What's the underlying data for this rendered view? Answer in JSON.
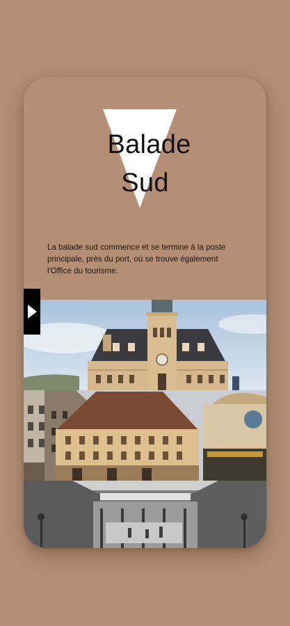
{
  "tour": {
    "title_line1": "Balade",
    "title_line2": "Sud",
    "description": "La balade sud commence et se termine à la poste principale, près du port, où se trouve également l'Office du tourisme.",
    "play_label": "play"
  },
  "photos": [
    "post-office-building-photo",
    "street-buildings-photo",
    "archival-street-photo"
  ],
  "colors": {
    "background": "#b48f76",
    "card": "#b48f76",
    "triangle": "#ffffff",
    "text": "#111111",
    "play_button": "#000000"
  }
}
